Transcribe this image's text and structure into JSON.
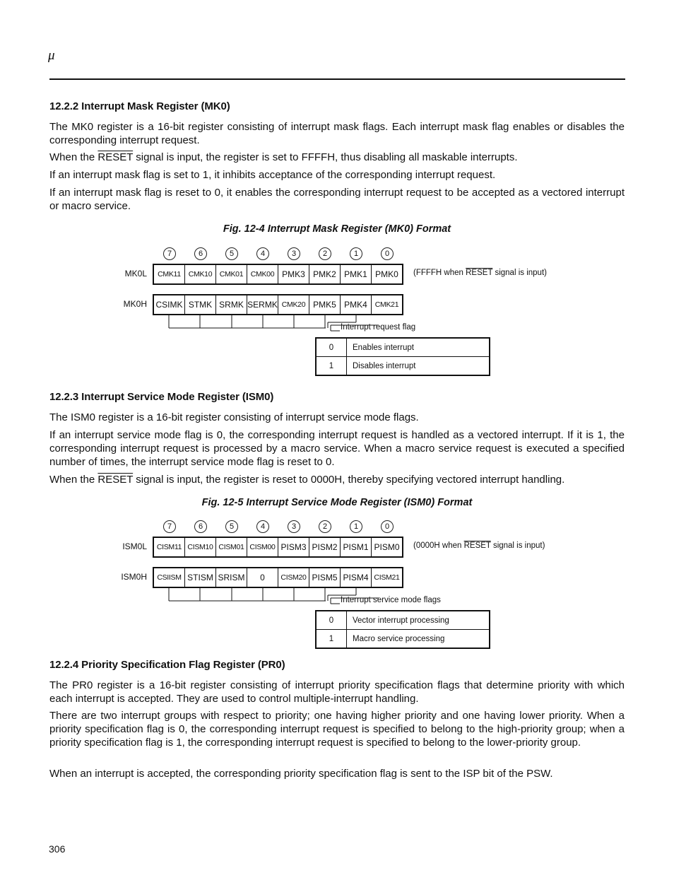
{
  "header": {
    "mu_symbol": "μ"
  },
  "sections": [
    {
      "heading": "12.2.2  Interrupt Mask Register (MK0)",
      "paragraphs": [
        {
          "parts": [
            "The MK0 register is a 16-bit register consisting of interrupt mask flags.  Each interrupt mask flag enables or disables the corresponding interrupt request."
          ]
        },
        {
          "parts": [
            "When the ",
            "RESET",
            " signal is input, the register is set to FFFFH, thus disabling all maskable interrupts."
          ]
        },
        {
          "parts": [
            "If an interrupt mask flag is set to 1, it inhibits acceptance of the corresponding interrupt request."
          ]
        },
        {
          "parts": [
            "If an interrupt mask flag is reset to 0, it enables the corresponding interrupt request to be accepted as a vectored interrupt or macro service."
          ]
        }
      ],
      "figure": {
        "caption": "Fig. 12-4  Interrupt Mask Register (MK0) Format",
        "bit_numbers": [
          "7",
          "6",
          "5",
          "4",
          "3",
          "2",
          "1",
          "0"
        ],
        "low": {
          "name": "MK0L",
          "bits": [
            "CMK11",
            "CMK10",
            "CMK01",
            "CMK00",
            "PMK3",
            "PMK2",
            "PMK1",
            "PMK0"
          ]
        },
        "high": {
          "name": "MK0H",
          "bits": [
            "CSIMK",
            "STMK",
            "SRMK",
            "SERMK",
            "CMK20",
            "PMK5",
            "PMK4",
            "CMK21"
          ]
        },
        "reset_note": {
          "pre": "(FFFFH when ",
          "signal": "RESET",
          "post": " signal is input)"
        },
        "flag_label": "Interrupt request flag",
        "values": [
          {
            "value": "0",
            "desc": "Enables interrupt"
          },
          {
            "value": "1",
            "desc": "Disables interrupt"
          }
        ]
      }
    },
    {
      "heading": "12.2.3  Interrupt Service Mode Register (ISM0)",
      "paragraphs": [
        {
          "parts": [
            "The ISM0 register is a 16-bit register consisting of interrupt service mode flags."
          ]
        },
        {
          "parts": [
            "If an interrupt service mode flag is 0, the corresponding interrupt request is handled as a vectored interrupt.  If it is 1, the corresponding interrupt request is processed by a macro service.  When a macro service request is executed a specified number of times, the interrupt service mode flag is reset to 0."
          ]
        },
        {
          "parts": [
            "When the ",
            "RESET",
            " signal is input, the register is reset to 0000H, thereby specifying vectored interrupt handling."
          ]
        }
      ],
      "figure": {
        "caption": "Fig. 12-5  Interrupt Service Mode Register (ISM0) Format",
        "bit_numbers": [
          "7",
          "6",
          "5",
          "4",
          "3",
          "2",
          "1",
          "0"
        ],
        "low": {
          "name": "ISM0L",
          "bits": [
            "CISM11",
            "CISM10",
            "CISM01",
            "CISM00",
            "PISM3",
            "PISM2",
            "PISM1",
            "PISM0"
          ]
        },
        "high": {
          "name": "ISM0H",
          "bits": [
            "CSIISM",
            "STISM",
            "SRISM",
            "0",
            "CISM20",
            "PISM5",
            "PISM4",
            "CISM21"
          ]
        },
        "reset_note": {
          "pre": "(0000H when ",
          "signal": "RESET",
          "post": " signal is input)"
        },
        "flag_label": "Interrupt service mode flags",
        "values": [
          {
            "value": "0",
            "desc": "Vector interrupt processing"
          },
          {
            "value": "1",
            "desc": "Macro service processing"
          }
        ]
      }
    },
    {
      "heading": "12.2.4  Priority Specification Flag Register (PR0)",
      "paragraphs": [
        {
          "parts": [
            "The PR0 register is a 16-bit register consisting of interrupt priority specification flags that determine priority with which each interrupt is accepted.  They are used to control multiple-interrupt handling."
          ]
        },
        {
          "parts": [
            "There are two interrupt groups with respect to priority; one having higher priority and one having lower priority. When a priority specification flag is 0, the corresponding interrupt request is specified to belong to the high-priority group; when a priority specification flag is 1, the corresponding interrupt request is specified to belong to the lower-priority group."
          ]
        },
        {
          "parts": [
            "When an interrupt is accepted, the corresponding priority specification flag is sent to the ISP bit of the PSW."
          ]
        }
      ]
    }
  ],
  "footer": {
    "page_number": "306"
  }
}
